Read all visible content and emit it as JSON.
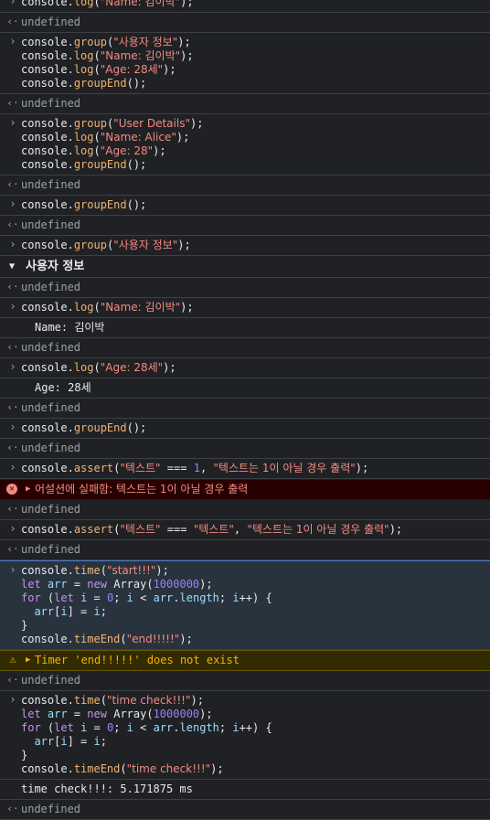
{
  "entries": [
    {
      "kind": "input",
      "lines": [
        "console.log(\"Name: 김이박\");"
      ]
    },
    {
      "kind": "result",
      "text": "undefined"
    },
    {
      "kind": "input",
      "lines": [
        "console.group(\"사용자 정보\");",
        "console.log(\"Name: 김이박\");",
        "console.log(\"Age: 28세\");",
        "console.groupEnd();"
      ]
    },
    {
      "kind": "result",
      "text": "undefined"
    },
    {
      "kind": "input",
      "lines": [
        "console.group(\"User Details\");",
        "console.log(\"Name: Alice\");",
        "console.log(\"Age: 28\");",
        "console.groupEnd();"
      ]
    },
    {
      "kind": "result",
      "text": "undefined"
    },
    {
      "kind": "input",
      "lines": [
        "console.groupEnd();"
      ]
    },
    {
      "kind": "result",
      "text": "undefined"
    },
    {
      "kind": "input",
      "lines": [
        "console.group(\"사용자 정보\");"
      ]
    },
    {
      "kind": "group",
      "text": "사용자 정보"
    },
    {
      "kind": "result",
      "text": "undefined"
    },
    {
      "kind": "input",
      "lines": [
        "console.log(\"Name: 김이박\");"
      ]
    },
    {
      "kind": "output",
      "text": "Name: 김이박"
    },
    {
      "kind": "result",
      "text": "undefined"
    },
    {
      "kind": "input",
      "lines": [
        "console.log(\"Age: 28세\");"
      ]
    },
    {
      "kind": "output",
      "text": "Age: 28세"
    },
    {
      "kind": "result",
      "text": "undefined"
    },
    {
      "kind": "input",
      "lines": [
        "console.groupEnd();"
      ]
    },
    {
      "kind": "result",
      "text": "undefined"
    },
    {
      "kind": "input",
      "lines": [
        "console.assert(\"텍스트\" === 1, \"텍스트는 1이 아닐 경우 출력\");"
      ]
    },
    {
      "kind": "error",
      "text": "어설션에 실패함: 텍스트는 1이 아닐 경우 출력"
    },
    {
      "kind": "result",
      "text": "undefined"
    },
    {
      "kind": "input",
      "lines": [
        "console.assert(\"텍스트\" === \"텍스트\", \"텍스트는 1이 아닐 경우 출력\");"
      ]
    },
    {
      "kind": "result",
      "text": "undefined"
    },
    {
      "kind": "input",
      "highlighted": true,
      "lines": [
        "console.time(\"start!!!\");",
        "let arr = new Array(1000000);",
        "for (let i = 0; i < arr.length; i++) {",
        "  arr[i] = i;",
        "}",
        "console.timeEnd(\"end!!!!!\");"
      ]
    },
    {
      "kind": "warning",
      "text": "Timer 'end!!!!!' does not exist"
    },
    {
      "kind": "result",
      "text": "undefined"
    },
    {
      "kind": "input",
      "lines": [
        "console.time(\"time check!!!\");",
        "let arr = new Array(1000000);",
        "for (let i = 0; i < arr.length; i++) {",
        "  arr[i] = i;",
        "}",
        "console.timeEnd(\"time check!!!\");"
      ]
    },
    {
      "kind": "output_plain",
      "text": "time check!!!: 5.171875 ms"
    },
    {
      "kind": "result",
      "text": "undefined"
    }
  ],
  "icons": {
    "input_prompt": "chevron-right-icon",
    "result_arrow": "return-arrow-icon",
    "error": "error-circle-icon",
    "warning": "warning-triangle-icon",
    "group_toggle": "triangle-down-icon"
  },
  "colors": {
    "background": "#202124",
    "error_bg": "#290000",
    "warning_bg": "#332b00",
    "string": "#f28b82",
    "number": "#9980ff",
    "method": "#f0b472"
  }
}
